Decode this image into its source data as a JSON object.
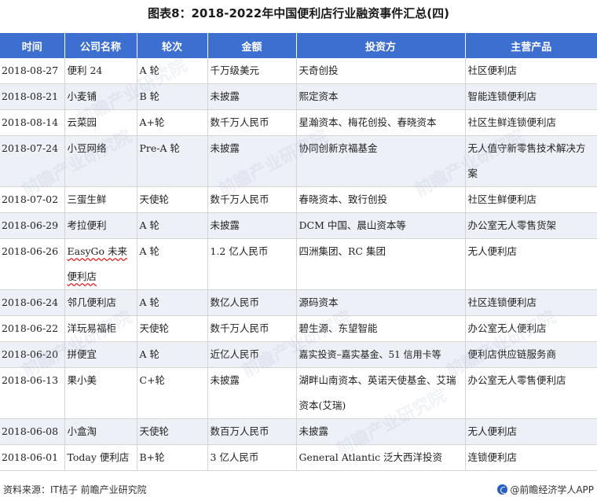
{
  "title": "图表8：2018-2022年中国便利店行业融资事件汇总(四)",
  "headers": [
    "时间",
    "公司名称",
    "轮次",
    "金额",
    "投资方",
    "主营产品"
  ],
  "rows": [
    {
      "date": "2018-08-27",
      "company": "便利 24",
      "round": "A 轮",
      "amount": "千万级美元",
      "investors": "天奇创投",
      "product": "社区便利店"
    },
    {
      "date": "2018-08-21",
      "company": "小麦铺",
      "round": "B 轮",
      "amount": "未披露",
      "investors": "熙定资本",
      "product": "智能连锁便利店"
    },
    {
      "date": "2018-08-14",
      "company": "云菜园",
      "round": "A+轮",
      "amount": "数千万人民币",
      "investors": "星瀚资本、梅花创投、春晓资本",
      "product": "社区生鲜连锁便利店"
    },
    {
      "date": "2018-07-24",
      "company": "小豆网络",
      "round": "Pre-A 轮",
      "amount": "未披露",
      "investors": "协同创新京福基金",
      "product": "无人值守新零售技术解决方案"
    },
    {
      "date": "2018-07-02",
      "company": "三蛋生鲜",
      "round": "天使轮",
      "amount": "数千万人民币",
      "investors": "春晓资本、致行创投",
      "product": "社区生鲜便利店"
    },
    {
      "date": "2018-06-29",
      "company": "考拉便利",
      "round": "A 轮",
      "amount": "未披露",
      "investors": "DCM 中国、晨山资本等",
      "product": "办公室无人零售货架"
    },
    {
      "date": "2018-06-26",
      "company": "EasyGo 未来便利店",
      "round": "A 轮",
      "amount": "1.2 亿人民币",
      "investors": "四洲集团、RC 集团",
      "product": "无人便利店"
    },
    {
      "date": "2018-06-24",
      "company": "邻几便利店",
      "round": "A 轮",
      "amount": "数亿人民币",
      "investors": "源码资本",
      "product": "社区连锁便利店"
    },
    {
      "date": "2018-06-22",
      "company": "洋玩易福柜",
      "round": "天使轮",
      "amount": "数千万人民币",
      "investors": "碧生源、东望智能",
      "product": "办公室无人便利店"
    },
    {
      "date": "2018-06-20",
      "company": "拼便宜",
      "round": "A 轮",
      "amount": "近亿人民币",
      "investors": "嘉实投资–嘉实基金、51 信用卡等",
      "product": "便利店供应链服务商"
    },
    {
      "date": "2018-06-13",
      "company": "果小美",
      "round": "C+轮",
      "amount": "未披露",
      "investors": "湖畔山南资本、英诺天使基金、艾瑞资本(艾瑞)",
      "product": "办公室无人零售便利店"
    },
    {
      "date": "2018-06-08",
      "company": "小盒淘",
      "round": "天使轮",
      "amount": "数百万人民币",
      "investors": "未披露",
      "product": "无人便利店"
    },
    {
      "date": "2018-06-01",
      "company": "Today 便利店",
      "round": "B+轮",
      "amount": "3 亿人民币",
      "investors": "General Atlantic 泛大西洋投资",
      "product": "连锁便利店"
    }
  ],
  "footer": {
    "source": "资料来源：IT桔子 前瞻产业研究院",
    "brand": "@前瞻经济学人APP"
  },
  "watermark_text": "前瞻产业研究院",
  "colors": {
    "header_bg": "#3d6fd1",
    "row_alt_bg": "#eef0f7"
  }
}
